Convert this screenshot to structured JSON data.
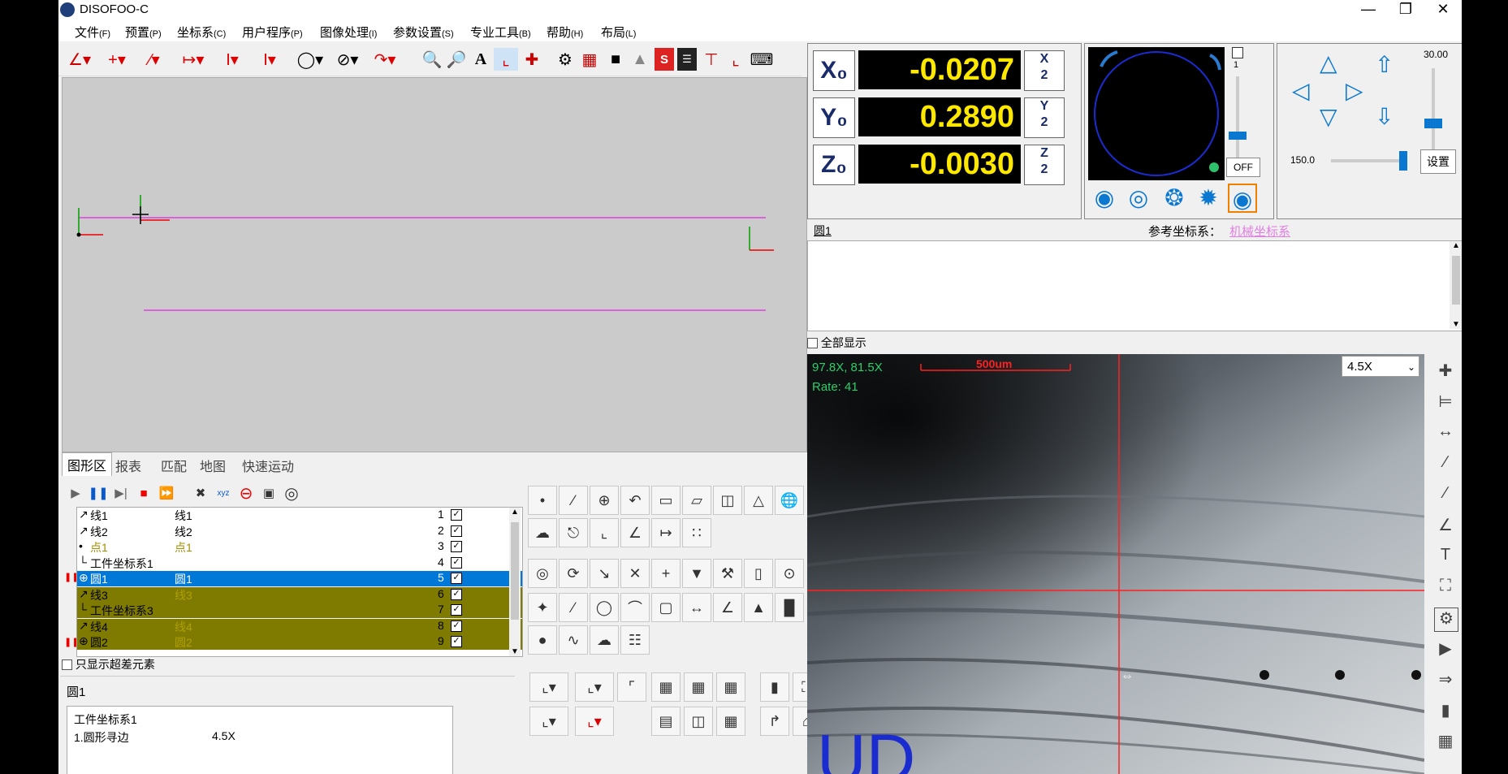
{
  "app": {
    "title": "DISOFOO-C"
  },
  "menu": [
    {
      "label": "文件",
      "key": "(F)"
    },
    {
      "label": "预置",
      "key": "(P)"
    },
    {
      "label": "坐标系",
      "key": "(C)"
    },
    {
      "label": "用户程序",
      "key": "(P)"
    },
    {
      "label": "图像处理",
      "key": "(I)"
    },
    {
      "label": "参数设置",
      "key": "(S)"
    },
    {
      "label": "专业工具",
      "key": "(B)"
    },
    {
      "label": "帮助",
      "key": "(H)"
    },
    {
      "label": "布局",
      "key": "(L)"
    }
  ],
  "tabs": [
    "图形区",
    "报表",
    "匹配",
    "地图",
    "快速运动"
  ],
  "elements": [
    {
      "name": "线1",
      "ref": "线1",
      "idx": "1",
      "style": "normal"
    },
    {
      "name": "线2",
      "ref": "线2",
      "idx": "2",
      "style": "normal"
    },
    {
      "name": "点1",
      "ref": "点1",
      "idx": "3",
      "style": "point"
    },
    {
      "name": "工件坐标系1",
      "ref": "",
      "idx": "4",
      "style": "normal"
    },
    {
      "name": "圆1",
      "ref": "圆1",
      "idx": "5",
      "style": "selected"
    },
    {
      "name": "线3",
      "ref": "线3",
      "idx": "6",
      "style": "olive"
    },
    {
      "name": "工件坐标系3",
      "ref": "",
      "idx": "7",
      "style": "olive"
    },
    {
      "name": "线4",
      "ref": "线4",
      "idx": "8",
      "style": "olive"
    },
    {
      "name": "圆2",
      "ref": "圆2",
      "idx": "9",
      "style": "olive"
    }
  ],
  "only_out_of_tol": "只显示超差元素",
  "details": {
    "title": "圆1",
    "line1": "工件坐标系1",
    "line2_label": "1.圆形寻边",
    "line2_value": "4.5X"
  },
  "dro": {
    "x": {
      "label": "X₀",
      "value": "-0.0207",
      "half": "X/2"
    },
    "y": {
      "label": "Y₀",
      "value": "0.2890",
      "half": "Y/2"
    },
    "z": {
      "label": "Z₀",
      "value": "-0.0030",
      "half": "Z/2"
    }
  },
  "light": {
    "off": "OFF",
    "level": "1"
  },
  "motion": {
    "speed_top": "30.00",
    "speed_left": "150.0",
    "settings": "设置"
  },
  "info": {
    "element": "圆1",
    "ref_label": "参考坐标系：",
    "ref_value": "机械坐标系",
    "show_all": "全部显示"
  },
  "camera": {
    "coords": "97.8X, 81.5X",
    "rate": "Rate: 41",
    "scale": "500um",
    "zoom": "4.5X",
    "overlay_text": "UD"
  },
  "colors": {
    "accent": "#0078d7",
    "olive": "#7f7a00",
    "dro_value": "#ffe800",
    "magenta": "#e040e0"
  }
}
